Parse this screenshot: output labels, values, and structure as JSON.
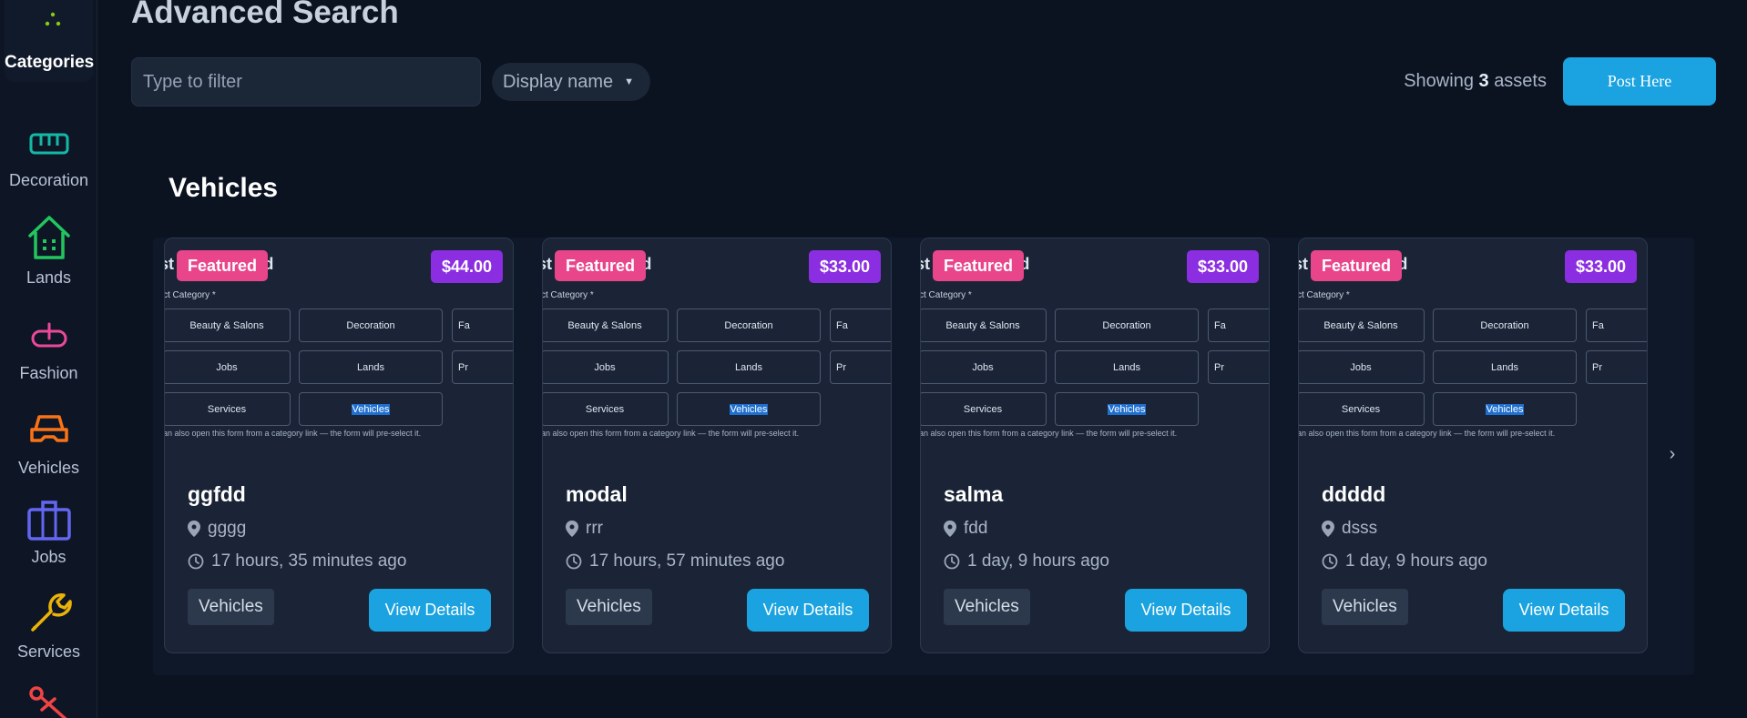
{
  "page": {
    "title": "Advanced Search",
    "filter_placeholder": "Type to filter",
    "sort_label": "Display name",
    "showing_prefix": "Showing",
    "showing_count": "3",
    "showing_suffix": "assets",
    "post_button": "Post Here",
    "section_title": "Vehicles",
    "next_arrow": "›"
  },
  "sidebar": {
    "header_label": "Categories",
    "items": [
      {
        "label": "Decoration",
        "icon": "decoration-icon",
        "color": "#14b8a6"
      },
      {
        "label": "Lands",
        "icon": "house-icon",
        "color": "#22c55e"
      },
      {
        "label": "Fashion",
        "icon": "fashion-icon",
        "color": "#ec4899"
      },
      {
        "label": "Vehicles",
        "icon": "car-icon",
        "color": "#f97316"
      },
      {
        "label": "Jobs",
        "icon": "briefcase-icon",
        "color": "#6366f1"
      },
      {
        "label": "Services",
        "icon": "wrench-icon",
        "color": "#eab308"
      }
    ],
    "scissors_icon_color": "#ef4444"
  },
  "thumbnail": {
    "heading": "st Featured Ad",
    "sub": "ct Category *",
    "options": [
      "Beauty & Salons",
      "Decoration",
      "Fa",
      "Jobs",
      "Lands",
      "Pr",
      "Services",
      "Vehicles"
    ],
    "note": "an also open this form from a category link — the form will pre-select it."
  },
  "cards": [
    {
      "featured": "Featured",
      "price": "$44.00",
      "title": "ggfdd",
      "location": "gggg",
      "time": "17 hours, 35 minutes ago",
      "category": "Vehicles",
      "button": "View Details"
    },
    {
      "featured": "Featured",
      "price": "$33.00",
      "title": "modal",
      "location": "rrr",
      "time": "17 hours, 57 minutes ago",
      "category": "Vehicles",
      "button": "View Details"
    },
    {
      "featured": "Featured",
      "price": "$33.00",
      "title": "salma",
      "location": "fdd",
      "time": "1 day, 9 hours ago",
      "category": "Vehicles",
      "button": "View Details"
    },
    {
      "featured": "Featured",
      "price": "$33.00",
      "title": "ddddd",
      "location": "dsss",
      "time": "1 day, 9 hours ago",
      "category": "Vehicles",
      "button": "View Details"
    }
  ],
  "colors": {
    "accent": "#1aa3e0",
    "featured": "#e8458b",
    "price": "#8b2de0",
    "background": "#0b1220",
    "card": "#1a2436"
  }
}
